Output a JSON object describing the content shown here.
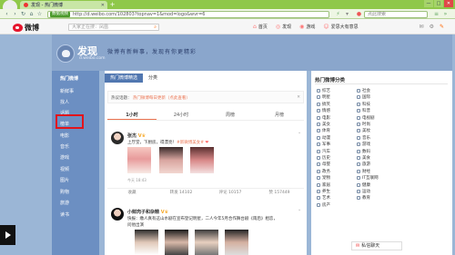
{
  "browser": {
    "tab_title": "发现 - 热门微博",
    "url": "http://d.weibo.com/102803?topnav=1&mod=logo&wvr=6",
    "secure_badge": "数据视频",
    "search_placeholder": "点此搜索",
    "controls": [
      "—",
      "□",
      "✕"
    ]
  },
  "weibo_nav": {
    "logo_text": "微博",
    "search_placeholder": "大家正在搜：凤凰",
    "items": [
      {
        "icon": "home-icon",
        "label": "首页"
      },
      {
        "icon": "discover-icon",
        "label": "发现"
      },
      {
        "icon": "game-icon",
        "label": "游戏"
      },
      {
        "icon": "user-icon",
        "label": "爱思大有意思"
      }
    ]
  },
  "banner": {
    "title": "发现",
    "subtitle": "d.weibo.com",
    "slogan": "微博有新鲜事，发现有你更精彩"
  },
  "left_nav": {
    "items": [
      "热门微博",
      "新鲜事",
      "找人",
      "话题",
      "榜单",
      "电影",
      "音乐",
      "游戏",
      "视频",
      "图片",
      "购物",
      "旅游",
      "读书"
    ],
    "active_index": 0
  },
  "main": {
    "tabs": [
      "热门微博精选",
      "分类"
    ],
    "notice": {
      "prefix": "热议话题：",
      "link": "热门微博每日更新（点此查看）",
      "close": "✕"
    },
    "time_tabs": [
      "1小时",
      "24小时",
      "周榜",
      "月榜"
    ],
    "posts": [
      {
        "name": "张杰",
        "text": "上厅堂，下厨房，得漂亮！",
        "tag": "#新微博美女#",
        "meta": "今天 18:43",
        "actions": [
          "收藏",
          "转发 14102",
          "评论 10157",
          "赞 157449"
        ]
      },
      {
        "name": "小鲜肉子和杂精",
        "text": "快报：缴人真有这山水剧在宣布登记明星，二人今年5月合作舞台剧《雨后》相恋，",
        "text2": "问他出演"
      }
    ]
  },
  "sidebar": {
    "title": "热门微博分类",
    "items": [
      "综艺",
      "社会",
      "明星",
      "国际",
      "搞笑",
      "科技",
      "情感",
      "科普",
      "电影",
      "电视剧",
      "美女",
      "时尚",
      "体育",
      "美妆",
      "动漫",
      "音乐",
      "军事",
      "游戏",
      "汽车",
      "数码",
      "历史",
      "美食",
      "母婴",
      "旅游",
      "政务",
      "财经",
      "宠物",
      "IT互联网",
      "家居",
      "健康",
      "养生",
      "运动",
      "艺术",
      "教育",
      "房产"
    ]
  },
  "message_bar": {
    "label": "私信聊天"
  }
}
